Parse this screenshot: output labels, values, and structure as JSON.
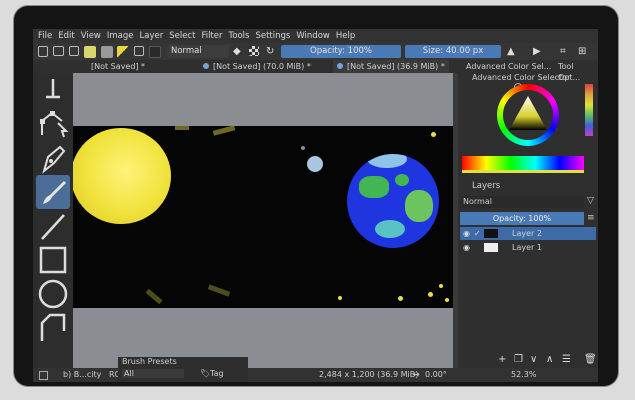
{
  "menu": [
    "File",
    "Edit",
    "View",
    "Image",
    "Layer",
    "Select",
    "Filter",
    "Tools",
    "Settings",
    "Window",
    "Help"
  ],
  "toolbar": {
    "blend_mode": "Normal",
    "opacity": "Opacity: 100%",
    "size": "Size: 40.00 px"
  },
  "tabs": [
    "[Not Saved] *",
    "[Not Saved] (70.0 MiB) *",
    "[Not Saved] (36.9 MiB) *"
  ],
  "dock": {
    "tab_color": "Advanced Color Sel...",
    "tab_tool": "Tool Opt...",
    "color_title": "Advanced Color Selector",
    "layers_title": "Layers",
    "layer_blend": "Normal",
    "layer_opacity": "Opacity:  100%",
    "layers": [
      {
        "name": "Layer 2",
        "selected": true
      },
      {
        "name": "Layer 1",
        "selected": false
      }
    ]
  },
  "brush_presets": {
    "title": "Brush Presets",
    "filter": "All",
    "tag": "Tag",
    "label": "b) B...city",
    "rg": "RG"
  },
  "status": {
    "dimensions": "2,484 x 1,200 (36.9 MiB)",
    "rotation": "0.00°",
    "zoom": "52.3%"
  },
  "colors": {
    "accent": "#4a7ab5",
    "selection": "#3d6ba8",
    "earth_blue": "#1f35e0",
    "earth_green": "#43b654",
    "sun": "#f0e23a"
  }
}
